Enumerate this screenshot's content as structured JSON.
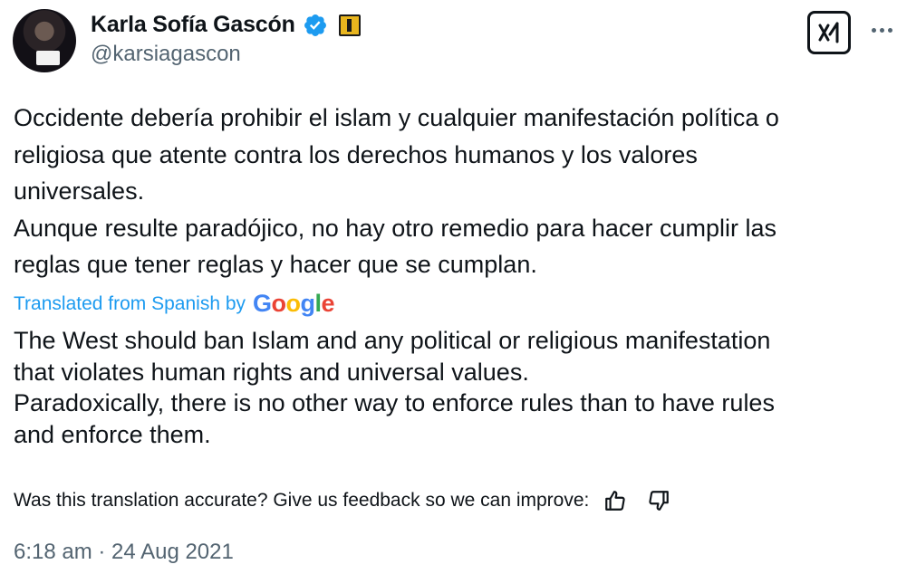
{
  "author": {
    "name": "Karla Sofía Gascón",
    "handle": "@karsiagascon",
    "verified_color": "#1d9bf0",
    "affiliate_badge_color": "#e8b51e"
  },
  "icons": {
    "verified": "verified-badge-icon",
    "grok": "grok-icon",
    "more": "more-options-icon",
    "thumbs_up": "thumbs-up-icon",
    "thumbs_down": "thumbs-down-icon"
  },
  "tweet": {
    "text": "Occidente debería prohibir el islam y cualquier manifestación política o\nreligiosa que atente contra los derechos humanos y los valores\nuniversales.\nAunque resulte paradójico, no hay otro remedio para hacer cumplir las\nreglas que tener reglas y hacer que se cumplan."
  },
  "translation": {
    "label": "Translated from Spanish by",
    "provider": "Google",
    "provider_colors": [
      "#4285f4",
      "#ea4335",
      "#fbbc05",
      "#4285f4",
      "#34a853",
      "#ea4335"
    ],
    "text": "The West should ban Islam and any political or religious manifestation\nthat violates human rights and universal values.\nParadoxically, there is no other way to enforce rules than to have rules\nand enforce them.",
    "feedback_prompt": "Was this translation accurate? Give us feedback so we can improve:"
  },
  "timestamp": "6:18 am · 24 Aug 2021",
  "colors": {
    "text": "#0f1419",
    "secondary": "#536471",
    "link": "#1d9bf0"
  }
}
